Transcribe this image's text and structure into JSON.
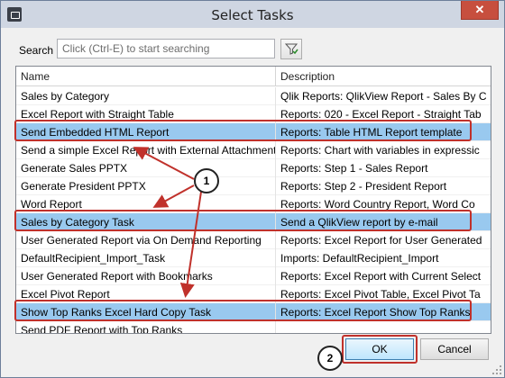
{
  "window": {
    "title": "Select Tasks",
    "close_label": "✕"
  },
  "search": {
    "label": "Search",
    "placeholder": "Click (Ctrl-E) to start searching"
  },
  "grid": {
    "columns": [
      "Name",
      "Description"
    ],
    "rows": [
      {
        "name": "Sales by Category",
        "description": "Qlik Reports: QlikView Report - Sales By C",
        "selected": false
      },
      {
        "name": "Excel Report with Straight Table",
        "description": "Reports: 020 - Excel Report - Straight Tab",
        "selected": false
      },
      {
        "name": "Send Embedded HTML Report",
        "description": "Reports: Table HTML Report template",
        "selected": true
      },
      {
        "name": "Send a simple Excel Report with External Attachment",
        "description": "Reports: Chart with variables in expressic",
        "selected": false
      },
      {
        "name": "Generate Sales PPTX",
        "description": "Reports: Step 1 - Sales Report",
        "selected": false
      },
      {
        "name": "Generate President PPTX",
        "description": "Reports: Step 2 - President Report",
        "selected": false
      },
      {
        "name": "Word Report",
        "description": "Reports: Word Country Report, Word Co",
        "selected": false
      },
      {
        "name": "Sales by Category Task",
        "description": "Send a QlikView report by e-mail",
        "selected": true
      },
      {
        "name": "User Generated Report via On Demand Reporting",
        "description": "Reports: Excel Report for User Generated",
        "selected": false
      },
      {
        "name": "DefaultRecipient_Import_Task",
        "description": "Imports: DefaultRecipient_Import",
        "selected": false
      },
      {
        "name": "User Generated Report with Bookmarks",
        "description": "Reports: Excel Report with Current Select",
        "selected": false
      },
      {
        "name": "Excel Pivot Report",
        "description": "Reports: Excel Pivot Table, Excel Pivot Ta",
        "selected": false
      },
      {
        "name": "Show Top Ranks Excel Hard Copy Task",
        "description": "Reports: Excel Report Show Top Ranks",
        "selected": true
      },
      {
        "name": "Send PDF Report with Top Ranks",
        "description": "",
        "selected": false
      }
    ]
  },
  "callouts": {
    "one": "1",
    "two": "2"
  },
  "buttons": {
    "ok": "OK",
    "cancel": "Cancel"
  },
  "colors": {
    "selection": "#99c9ef",
    "highlight": "#c0312b"
  }
}
